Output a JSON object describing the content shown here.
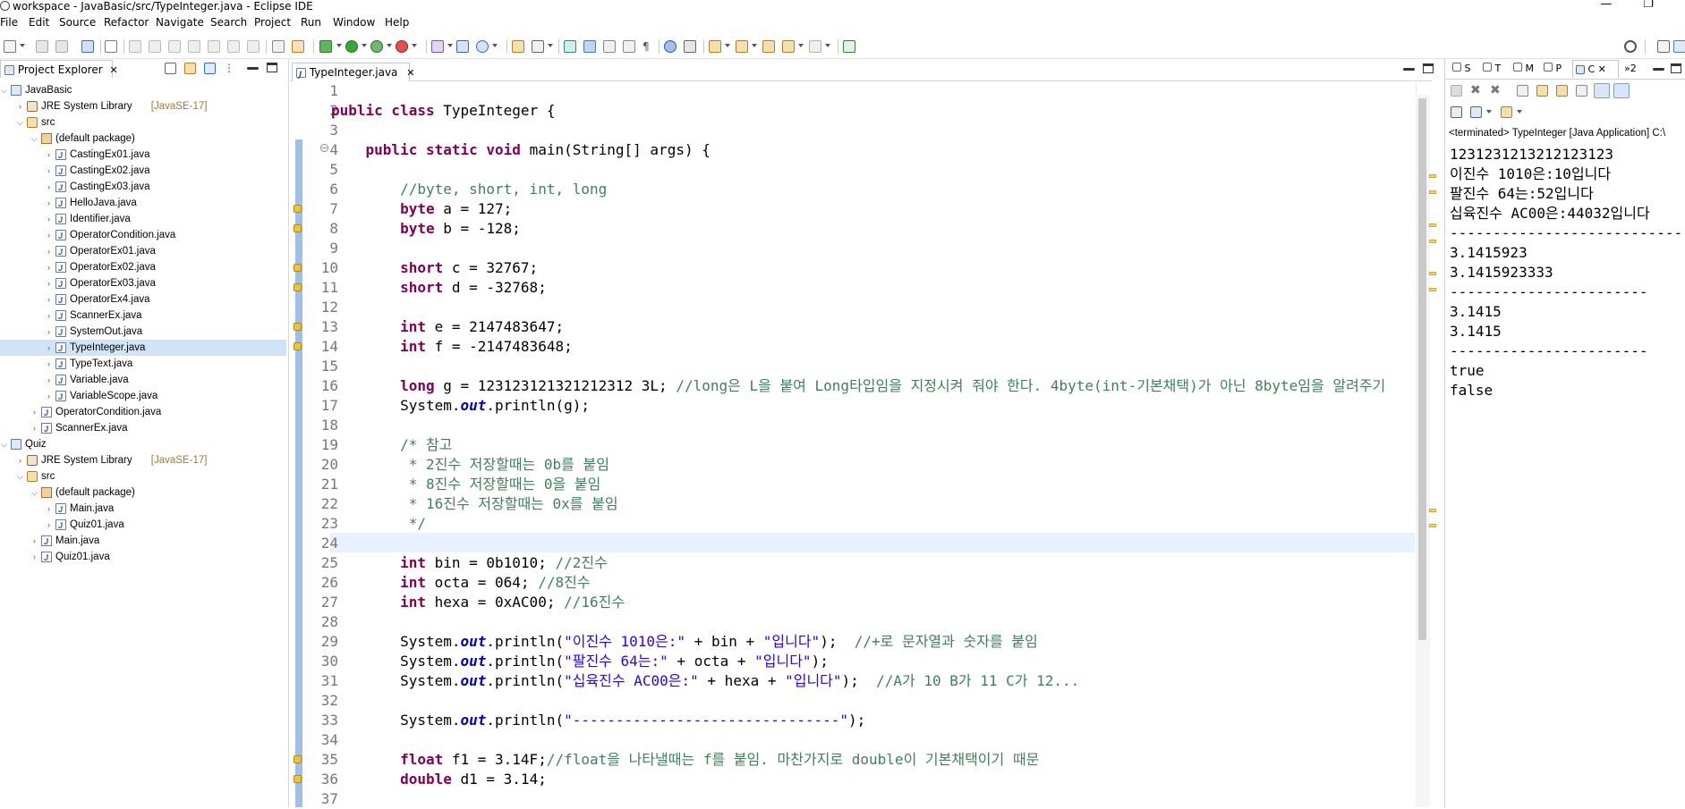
{
  "window": {
    "title": "workspace - JavaBasic/src/TypeInteger.java - Eclipse IDE",
    "minimize": "—",
    "maximize": "❐"
  },
  "menu": [
    "File",
    "Edit",
    "Source",
    "Refactor",
    "Navigate",
    "Search",
    "Project",
    "Run",
    "Window",
    "Help"
  ],
  "project_explorer": {
    "tab_label": "Project Explorer",
    "close": "✕",
    "rows": [
      {
        "label": "JavaBasic",
        "icon": "project-icon",
        "depth": 0,
        "expanded": true
      },
      {
        "label": "JRE System Library",
        "decor": "[JavaSE-17]",
        "icon": "library-icon",
        "depth": 1,
        "expanded": false
      },
      {
        "label": "src",
        "icon": "source-folder-icon",
        "depth": 1,
        "expanded": true
      },
      {
        "label": "(default package)",
        "icon": "package-icon",
        "depth": 2,
        "expanded": true
      },
      {
        "label": "CastingEx01.java",
        "icon": "java-file-icon",
        "depth": 3,
        "expanded": false
      },
      {
        "label": "CastingEx02.java",
        "icon": "java-file-icon",
        "depth": 3,
        "expanded": false
      },
      {
        "label": "CastingEx03.java",
        "icon": "java-file-icon",
        "depth": 3,
        "expanded": false
      },
      {
        "label": "HelloJava.java",
        "icon": "java-file-icon",
        "depth": 3,
        "expanded": false
      },
      {
        "label": "Identifier.java",
        "icon": "java-file-icon",
        "depth": 3,
        "expanded": false
      },
      {
        "label": "OperatorCondition.java",
        "icon": "java-file-icon",
        "depth": 3,
        "expanded": false
      },
      {
        "label": "OperatorEx01.java",
        "icon": "java-file-icon",
        "depth": 3,
        "expanded": false
      },
      {
        "label": "OperatorEx02.java",
        "icon": "java-file-icon",
        "depth": 3,
        "expanded": false
      },
      {
        "label": "OperatorEx03.java",
        "icon": "java-file-icon",
        "depth": 3,
        "expanded": false
      },
      {
        "label": "OperatorEx4.java",
        "icon": "java-file-icon",
        "depth": 3,
        "expanded": false
      },
      {
        "label": "ScannerEx.java",
        "icon": "java-file-icon",
        "depth": 3,
        "expanded": false
      },
      {
        "label": "SystemOut.java",
        "icon": "java-file-icon",
        "depth": 3,
        "expanded": false
      },
      {
        "label": "TypeInteger.java",
        "icon": "java-file-icon",
        "depth": 3,
        "expanded": false,
        "selected": true
      },
      {
        "label": "TypeText.java",
        "icon": "java-file-icon",
        "depth": 3,
        "expanded": false
      },
      {
        "label": "Variable.java",
        "icon": "java-file-icon",
        "depth": 3,
        "expanded": false
      },
      {
        "label": "VariableScope.java",
        "icon": "java-file-icon",
        "depth": 3,
        "expanded": false
      },
      {
        "label": "OperatorCondition.java",
        "icon": "java-file-icon",
        "depth": 2,
        "expanded": false
      },
      {
        "label": "ScannerEx.java",
        "icon": "java-file-icon",
        "depth": 2,
        "expanded": false
      },
      {
        "label": "Quiz",
        "icon": "project-icon",
        "depth": 0,
        "expanded": true
      },
      {
        "label": "JRE System Library",
        "decor": "[JavaSE-17]",
        "icon": "library-icon",
        "depth": 1,
        "expanded": false
      },
      {
        "label": "src",
        "icon": "source-folder-icon",
        "depth": 1,
        "expanded": true
      },
      {
        "label": "(default package)",
        "icon": "package-icon",
        "depth": 2,
        "expanded": true
      },
      {
        "label": "Main.java",
        "icon": "java-file-icon",
        "depth": 3,
        "expanded": false
      },
      {
        "label": "Quiz01.java",
        "icon": "java-file-icon",
        "depth": 3,
        "expanded": false
      },
      {
        "label": "Main.java",
        "icon": "java-file-icon",
        "depth": 2,
        "expanded": false
      },
      {
        "label": "Quiz01.java",
        "icon": "java-file-icon",
        "depth": 2,
        "expanded": false
      }
    ]
  },
  "editor": {
    "tab_label": "TypeInteger.java",
    "close": "✕",
    "lines": [
      [],
      [
        [
          "kw",
          "public class "
        ],
        [
          "",
          "TypeInteger {"
        ]
      ],
      [],
      [
        [
          "",
          "    "
        ],
        [
          "kw",
          "public static void "
        ],
        [
          "",
          "main(String[] args) {"
        ]
      ],
      [],
      [
        [
          "",
          "        "
        ],
        [
          "cm",
          "//byte, short, int, long"
        ]
      ],
      [
        [
          "",
          "        "
        ],
        [
          "kw",
          "byte "
        ],
        [
          "",
          "a = 127;"
        ]
      ],
      [
        [
          "",
          "        "
        ],
        [
          "kw",
          "byte "
        ],
        [
          "",
          "b = -128;"
        ]
      ],
      [],
      [
        [
          "",
          "        "
        ],
        [
          "kw",
          "short "
        ],
        [
          "",
          "c = 32767;"
        ]
      ],
      [
        [
          "",
          "        "
        ],
        [
          "kw",
          "short "
        ],
        [
          "",
          "d = -32768;"
        ]
      ],
      [],
      [
        [
          "",
          "        "
        ],
        [
          "kw",
          "int "
        ],
        [
          "",
          "e = 2147483647;"
        ]
      ],
      [
        [
          "",
          "        "
        ],
        [
          "kw",
          "int "
        ],
        [
          "",
          "f = -2147483648;"
        ]
      ],
      [],
      [
        [
          "",
          "        "
        ],
        [
          "kw",
          "long "
        ],
        [
          "",
          "g = 123123121321212312 3L; "
        ],
        [
          "cm",
          "//long은 L을 붙여 Long타입임을 지정시켜 줘야 한다. 4byte(int-기본채택)가 아닌 8byte임을 알려주기"
        ]
      ],
      [
        [
          "",
          "        System."
        ],
        [
          "fi",
          "out"
        ],
        [
          "",
          ".println(g);"
        ]
      ],
      [],
      [
        [
          "",
          "        "
        ],
        [
          "cm",
          "/* 참고"
        ]
      ],
      [
        [
          "",
          "        "
        ],
        [
          "cm",
          " * 2진수 저장할때는 0b를 붙임"
        ]
      ],
      [
        [
          "",
          "        "
        ],
        [
          "cm",
          " * 8진수 저장할때는 0을 붙임"
        ]
      ],
      [
        [
          "",
          "        "
        ],
        [
          "cm",
          " * 16진수 저장할때는 0x를 붙임"
        ]
      ],
      [
        [
          "",
          "        "
        ],
        [
          "cm",
          " */"
        ]
      ],
      [],
      [
        [
          "",
          "        "
        ],
        [
          "kw",
          "int "
        ],
        [
          "",
          "bin = 0b1010; "
        ],
        [
          "cm",
          "//2진수"
        ]
      ],
      [
        [
          "",
          "        "
        ],
        [
          "kw",
          "int "
        ],
        [
          "",
          "octa = 064; "
        ],
        [
          "cm",
          "//8진수"
        ]
      ],
      [
        [
          "",
          "        "
        ],
        [
          "kw",
          "int "
        ],
        [
          "",
          "hexa = 0xAC00; "
        ],
        [
          "cm",
          "//16진수"
        ]
      ],
      [],
      [
        [
          "",
          "        System."
        ],
        [
          "fi",
          "out"
        ],
        [
          "",
          ".println("
        ],
        [
          "st",
          "\"이진수 1010은:\""
        ],
        [
          "",
          " + bin + "
        ],
        [
          "st",
          "\"입니다\""
        ],
        [
          "",
          ");  "
        ],
        [
          "cm",
          "//+로 문자열과 숫자를 붙임"
        ]
      ],
      [
        [
          "",
          "        System."
        ],
        [
          "fi",
          "out"
        ],
        [
          "",
          ".println("
        ],
        [
          "st",
          "\"팔진수 64는:\""
        ],
        [
          "",
          " + octa + "
        ],
        [
          "st",
          "\"입니다\""
        ],
        [
          "",
          ");"
        ]
      ],
      [
        [
          "",
          "        System."
        ],
        [
          "fi",
          "out"
        ],
        [
          "",
          ".println("
        ],
        [
          "st",
          "\"십육진수 AC00은:\""
        ],
        [
          "",
          " + hexa + "
        ],
        [
          "st",
          "\"입니다\""
        ],
        [
          "",
          ");  "
        ],
        [
          "cm",
          "//A가 10 B가 11 C가 12..."
        ]
      ],
      [],
      [
        [
          "",
          "        System."
        ],
        [
          "fi",
          "out"
        ],
        [
          "",
          ".println("
        ],
        [
          "st",
          "\"-------------------------------\""
        ],
        [
          "",
          ");"
        ]
      ],
      [],
      [
        [
          "",
          "        "
        ],
        [
          "kw",
          "float "
        ],
        [
          "",
          "f1 = 3.14F;"
        ],
        [
          "cm",
          "//float을 나타낼때는 f를 붙임. 마찬가지로 double이 기본채택이기 때문"
        ]
      ],
      [
        [
          "",
          "        "
        ],
        [
          "kw",
          "double "
        ],
        [
          "",
          "d1 = 3.14;"
        ]
      ],
      []
    ]
  },
  "console": {
    "status": "<terminated> TypeInteger [Java Application] C:\\",
    "tabs": [
      "S",
      "T",
      "M",
      "P",
      "C",
      "»2"
    ],
    "output": [
      "1231231213212123123",
      "이진수 1010은:10입니다",
      "팔진수 64는:52입니다",
      "십육진수 AC00은:44032입니다",
      "-------------------------------",
      "3.1415923",
      "3.1415923333",
      "-----------------------",
      "3.1415",
      "3.1415",
      "-----------------------",
      "true",
      "false"
    ]
  },
  "colors": {
    "keyword": "#7f0055",
    "comment": "#3f7f5f",
    "string": "#2a00ff",
    "static_field": "#0000c0",
    "current_line": "#e8f2fe",
    "selection": "#d0e4f7"
  }
}
